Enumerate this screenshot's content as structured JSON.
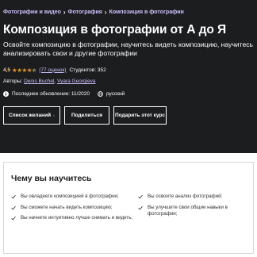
{
  "breadcrumb": [
    "Фотографии и видео",
    "Фотография",
    "Композиция в фотографии"
  ],
  "course": {
    "title": "Композиция в фотографии от А до Я",
    "subtitle": "Освойте композицию в фотографии, научитесь видеть композицию, научитесь анализировать свои и другие фотографии",
    "rating": "4,5",
    "stars_value": 4.5,
    "stars_max": 5,
    "reviews_link": "(77 оценок)",
    "students": "Студентов: 352",
    "authors_label": "Авторы:",
    "authors": [
      "Denis Buchel",
      "Vyara Georgieva"
    ],
    "last_updated": "Последнее обновление: 11/2020",
    "language": "русский"
  },
  "buttons": {
    "wishlist": "Список желаний",
    "share": "Поделиться",
    "gift": "Подарить этот курс"
  },
  "learn": {
    "title": "Чему вы научитесь",
    "left": [
      "Вы овладеете композицией в фотографии;",
      "Вы сможете начать видеть композицию;",
      "Вы начнете интуитивно лучше снимать и видеть;"
    ],
    "right": [
      "Вы освоите анализ фотографий;",
      "Вы улучшите свои общие навыки в фотографии;"
    ]
  },
  "colors": {
    "hero_bg": "#1c1d1f",
    "link": "#cec0fc",
    "rating": "#f3ca8c",
    "stars": "#e59819"
  }
}
